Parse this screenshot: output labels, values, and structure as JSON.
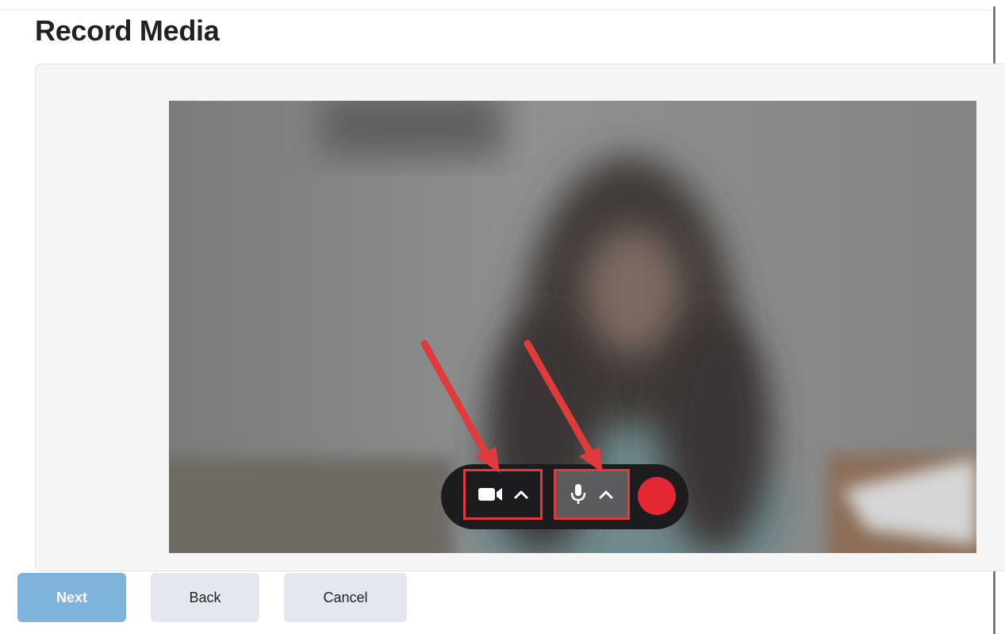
{
  "header": {
    "title": "Record Media"
  },
  "recorder": {
    "camera_control": {
      "icon": "video-camera-icon",
      "menu_icon": "chevron-up-icon"
    },
    "mic_control": {
      "icon": "microphone-icon",
      "menu_icon": "chevron-up-icon"
    },
    "record_color": "#e32733",
    "highlight_color": "#e03a3a"
  },
  "footer": {
    "next_label": "Next",
    "back_label": "Back",
    "cancel_label": "Cancel"
  }
}
